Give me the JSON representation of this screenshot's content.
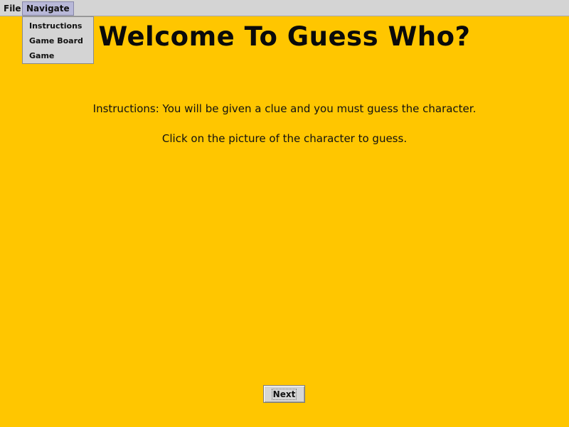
{
  "menubar": {
    "file_label": "File",
    "navigate_label": "Navigate"
  },
  "navigate_menu": {
    "items": [
      {
        "label": "Instructions"
      },
      {
        "label": "Game Board"
      },
      {
        "label": "Game"
      }
    ]
  },
  "main": {
    "title": "Welcome To Guess Who?",
    "instruction_line_1": "Instructions:  You will be given a clue and you must guess the character.",
    "instruction_line_2": "Click on the picture of the character to guess."
  },
  "footer": {
    "next_label": "Next"
  },
  "colors": {
    "background": "#ffc600",
    "menubar": "#d4d4d4",
    "menu_selected": "#b8b8d8"
  }
}
